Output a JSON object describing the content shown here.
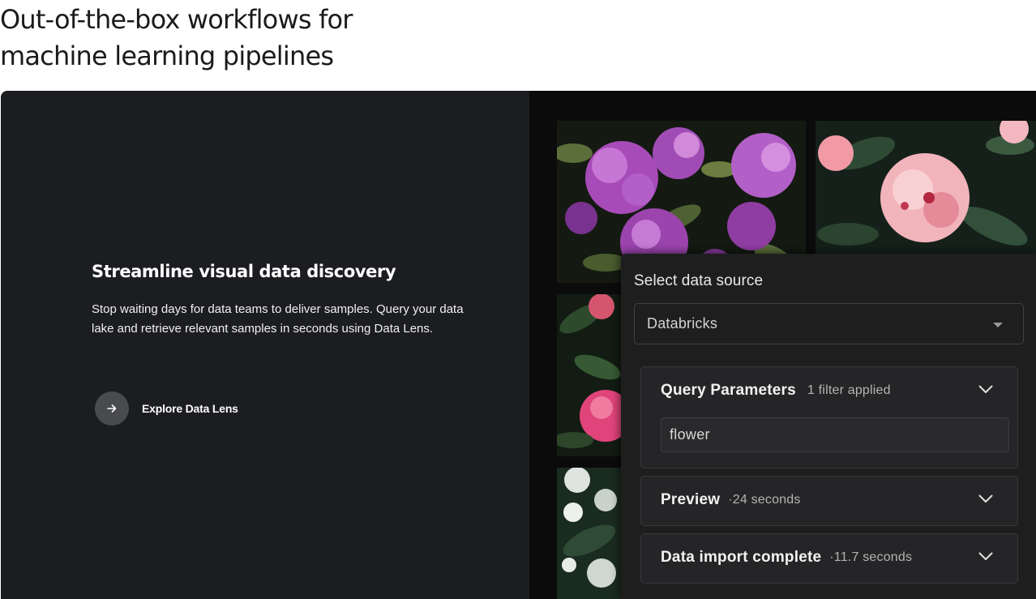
{
  "page": {
    "heading_line1": "Out-of-the-box workflows for",
    "heading_line2": "machine learning pipelines"
  },
  "feature": {
    "title": "Streamline visual data discovery",
    "description": "Stop waiting days for data teams to deliver samples. Query your data lake and retrieve relevant samples in seconds using Data Lens.",
    "cta_label": "Explore Data Lens",
    "cta_icon": "arrow-right-icon"
  },
  "data_panel": {
    "source_label": "Select data source",
    "source_value": "Databricks",
    "sections": [
      {
        "title": "Query Parameters",
        "meta": "1 filter applied",
        "expanded": true,
        "query_value": "flower"
      },
      {
        "title": "Preview",
        "meta": "·24 seconds",
        "expanded": false
      },
      {
        "title": "Data import complete",
        "meta": "·11.7 seconds",
        "expanded": false
      }
    ]
  },
  "colors": {
    "card_background": "#1c1d20",
    "gallery_background": "#0b0b0c",
    "panel_background": "#1e1e1f",
    "accent_purple": "#b35fc8",
    "accent_pink": "#f2a9b2"
  }
}
